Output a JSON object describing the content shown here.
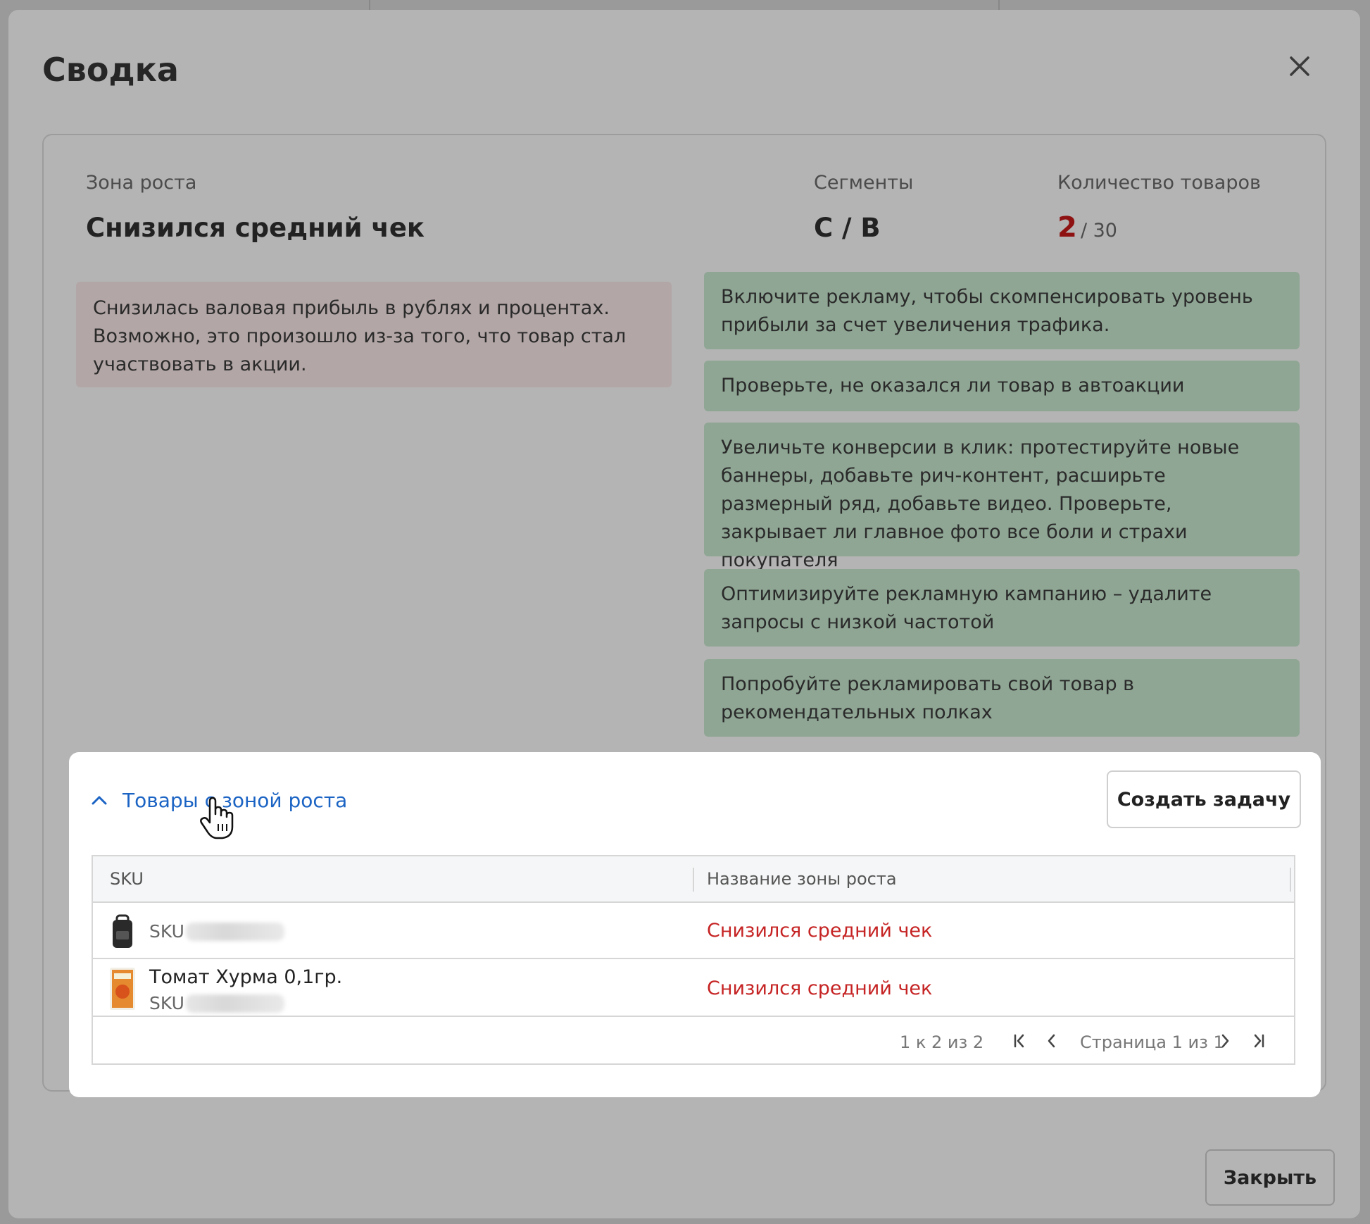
{
  "modal": {
    "title": "Сводка",
    "close_button_label": "Закрыть"
  },
  "summary": {
    "growth_zone_label": "Зона роста",
    "growth_zone_value": "Снизился средний чек",
    "segments_label": "Сегменты",
    "segments_value": "C / B",
    "count_label": "Количество товаров",
    "count_value": "2",
    "count_total": "/ 30",
    "issue_text": "Снизилась валовая прибыль в рублях и процентах. Возможно, это произошло из-за того, что товар стал участвовать в акции.",
    "recommendations": [
      "Включите рекламу, чтобы скомпенсировать уровень прибыли за счет увеличения трафика.",
      "Проверьте, не оказался ли товар в автоакции",
      "Увеличьте конверсии в клик: протестируйте новые баннеры, добавьте рич-контент, расширьте размерный ряд, добавьте видео. Проверьте, закрывает ли главное фото все боли и страхи покупателя",
      "Оптимизируйте рекламную кампанию – удалите запросы с низкой частотой",
      "Попробуйте рекламировать свой товар в рекомендательных полках"
    ]
  },
  "products": {
    "toggle_label": "Товары с зоной роста",
    "create_task_label": "Создать задачу",
    "columns": [
      "SKU",
      "Название зоны роста"
    ],
    "rows": [
      {
        "name": "",
        "sku_prefix": "SKU",
        "zone": "Снизился средний чек"
      },
      {
        "name": "Томат Хурма 0,1гр.",
        "sku_prefix": "SKU",
        "zone": "Снизился средний чек"
      }
    ],
    "pagination": {
      "range": "1 к 2 из 2",
      "page": "Страница 1 из 1"
    }
  },
  "colors": {
    "link": "#1c64c4",
    "zone_red": "#c62424",
    "count_red": "#8e1212",
    "issue_bg": "#b3a6a6",
    "recommendation_bg": "#8fa694"
  },
  "icons": [
    "close-icon",
    "chevron-up-icon",
    "first-page-icon",
    "prev-page-icon",
    "next-page-icon",
    "last-page-icon",
    "hand-cursor-icon"
  ]
}
